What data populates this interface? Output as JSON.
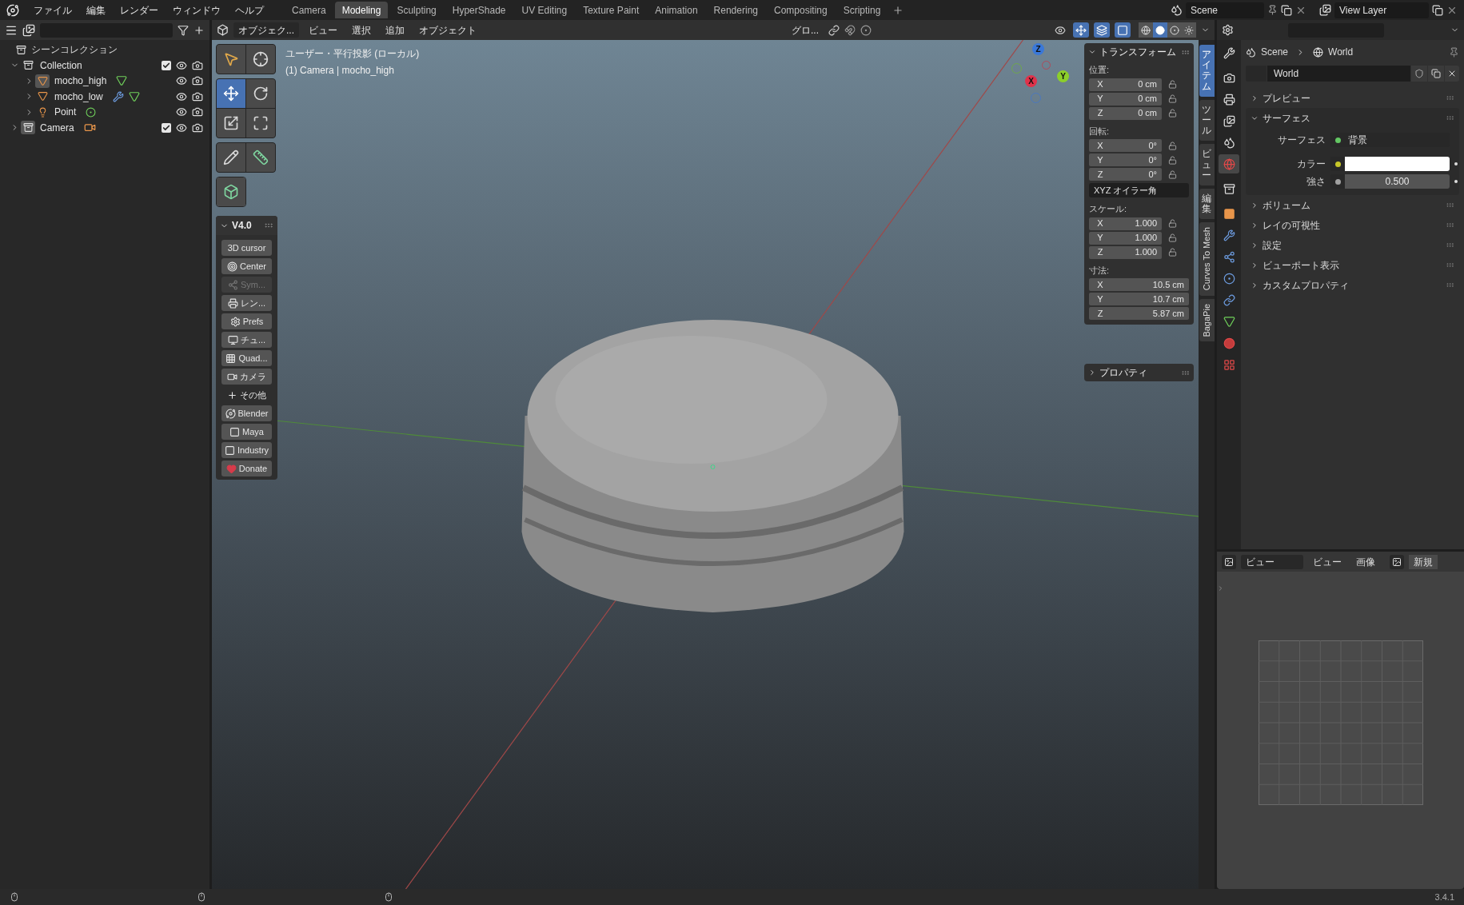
{
  "menubar": {
    "menus": [
      "ファイル",
      "編集",
      "レンダー",
      "ウィンドウ",
      "ヘルプ"
    ],
    "workspaces": [
      {
        "label": "Camera",
        "selected": false
      },
      {
        "label": "Modeling",
        "selected": true
      },
      {
        "label": "Sculpting",
        "selected": false
      },
      {
        "label": "HyperShade",
        "selected": false
      },
      {
        "label": "UV Editing",
        "selected": false
      },
      {
        "label": "Texture Paint",
        "selected": false
      },
      {
        "label": "Animation",
        "selected": false
      },
      {
        "label": "Rendering",
        "selected": false
      },
      {
        "label": "Compositing",
        "selected": false
      },
      {
        "label": "Scripting",
        "selected": false
      }
    ],
    "scene": "Scene",
    "view_layer": "View Layer"
  },
  "outliner": {
    "root": "シーンコレクション",
    "items": [
      {
        "label": "Collection",
        "kind": "collection",
        "expanded": true,
        "active": false,
        "checked": true,
        "children": [
          {
            "label": "mocho_high",
            "kind": "mesh",
            "expanded": false,
            "active": true,
            "modifier": false
          },
          {
            "label": "mocho_low",
            "kind": "mesh",
            "expanded": false,
            "active": false,
            "modifier": true
          },
          {
            "label": "Point",
            "kind": "light",
            "expanded": false,
            "active": false
          }
        ]
      },
      {
        "label": "Camera",
        "kind": "camera_collection",
        "expanded": false,
        "active": true,
        "checked": true
      }
    ]
  },
  "viewport": {
    "mode": "オブジェク...",
    "menus": [
      "ビュー",
      "選択",
      "追加",
      "オブジェクト"
    ],
    "orientation": "グロ...",
    "toggles": [
      {
        "kind": "visibility",
        "on": false
      },
      {
        "kind": "gizmo",
        "on": true
      },
      {
        "kind": "overlay",
        "on": true
      },
      {
        "kind": "xray",
        "on": true
      }
    ],
    "shading": [
      {
        "kind": "wireframe",
        "selected": false
      },
      {
        "kind": "solid",
        "selected": true
      },
      {
        "kind": "material",
        "selected": false
      },
      {
        "kind": "rendered",
        "selected": false
      }
    ],
    "overlay_text": [
      "ユーザー・平行投影 (ローカル)",
      "(1) Camera | mocho_high"
    ],
    "tool_groups": [
      {
        "tools": [
          {
            "kind": "select_box",
            "selected": false
          },
          {
            "kind": "cursor",
            "selected": false
          }
        ]
      },
      {
        "tools": [
          {
            "kind": "move",
            "selected": true
          },
          {
            "kind": "rotate",
            "selected": false
          },
          {
            "kind": "scale",
            "selected": false
          },
          {
            "kind": "transform",
            "selected": false
          }
        ]
      },
      {
        "tools": [
          {
            "kind": "annotate",
            "selected": false
          },
          {
            "kind": "measure",
            "selected": false
          }
        ]
      },
      {
        "tools": [
          {
            "kind": "add_cube",
            "selected": false
          }
        ]
      }
    ],
    "addon_panel": {
      "title": "V4.0",
      "buttons": [
        {
          "label": "3D cursor",
          "kind": "plain",
          "disabled": false
        },
        {
          "label": "Center",
          "kind": "center",
          "disabled": false
        },
        {
          "label": "Sym...",
          "kind": "sym",
          "disabled": true
        },
        {
          "label": "レン...",
          "kind": "render",
          "disabled": false
        },
        {
          "label": "Prefs",
          "kind": "prefs",
          "disabled": false
        },
        {
          "label": "チュ...",
          "kind": "tutorial",
          "disabled": false
        },
        {
          "label": "Quad...",
          "kind": "quad",
          "disabled": false
        },
        {
          "label": "カメラ",
          "kind": "camera",
          "disabled": false
        },
        {
          "label": "その他",
          "kind": "more",
          "disabled": false
        },
        {
          "label": "Blender",
          "kind": "blender",
          "disabled": false
        },
        {
          "label": "Maya",
          "kind": "maya",
          "disabled": false
        },
        {
          "label": "Industry",
          "kind": "industry",
          "disabled": false
        },
        {
          "label": "Donate",
          "kind": "donate",
          "disabled": false
        }
      ]
    },
    "gizmo": {
      "x": "X",
      "y": "Y",
      "z": "Z"
    },
    "side_tabs": [
      {
        "label": "アイテム",
        "kind": "cjk",
        "selected": true
      },
      {
        "label": "ツール",
        "kind": "cjk",
        "selected": false
      },
      {
        "label": "ビュー",
        "kind": "cjk",
        "selected": false
      },
      {
        "label": "編集",
        "kind": "cjk",
        "selected": false
      },
      {
        "label": "Curves To Mesh",
        "kind": "latin",
        "selected": false
      },
      {
        "label": "BagaPie",
        "kind": "latin",
        "selected": false
      }
    ],
    "transform": {
      "title": "トランスフォーム",
      "groups": [
        {
          "kind": "vector",
          "label": "位置:",
          "lockable": true,
          "rows": [
            {
              "axis": "X",
              "value": "0 cm"
            },
            {
              "axis": "Y",
              "value": "0 cm"
            },
            {
              "axis": "Z",
              "value": "0 cm"
            }
          ]
        },
        {
          "kind": "vector",
          "label": "回転:",
          "lockable": true,
          "rows": [
            {
              "axis": "X",
              "value": "0°"
            },
            {
              "axis": "Y",
              "value": "0°"
            },
            {
              "axis": "Z",
              "value": "0°"
            }
          ]
        },
        {
          "kind": "dropdown",
          "value": "XYZ オイラー角"
        },
        {
          "kind": "vector",
          "label": "スケール:",
          "lockable": true,
          "rows": [
            {
              "axis": "X",
              "value": "1.000"
            },
            {
              "axis": "Y",
              "value": "1.000"
            },
            {
              "axis": "Z",
              "value": "1.000"
            }
          ]
        },
        {
          "kind": "vector",
          "label": "寸法:",
          "lockable": false,
          "rows": [
            {
              "axis": "X",
              "value": "10.5 cm"
            },
            {
              "axis": "Y",
              "value": "10.7 cm"
            },
            {
              "axis": "Z",
              "value": "5.87 cm"
            }
          ]
        }
      ]
    },
    "properties_panel": {
      "title": "プロパティ",
      "expanded": false
    }
  },
  "properties": {
    "tabs": [
      {
        "kind": "tool",
        "selected": false
      },
      {
        "kind": "render",
        "selected": false
      },
      {
        "kind": "output",
        "selected": false
      },
      {
        "kind": "view_layer",
        "selected": false
      },
      {
        "kind": "scene",
        "selected": false
      },
      {
        "kind": "world",
        "selected": true
      },
      {
        "kind": "collection",
        "selected": false
      },
      {
        "kind": "object",
        "selected": false
      },
      {
        "kind": "modifier",
        "selected": false
      },
      {
        "kind": "particles",
        "selected": false
      },
      {
        "kind": "physics",
        "selected": false
      },
      {
        "kind": "constraints",
        "selected": false
      },
      {
        "kind": "data",
        "selected": false
      },
      {
        "kind": "material",
        "selected": false
      },
      {
        "kind": "texture",
        "selected": false
      }
    ],
    "breadcrumb": [
      "Scene",
      "World"
    ],
    "world": "World",
    "sections": [
      {
        "label": "プレビュー",
        "expanded": false
      },
      {
        "label": "サーフェス",
        "expanded": true,
        "fields": [
          {
            "label": "サーフェス",
            "kind": "shader",
            "value": "背景",
            "color": "#63c763"
          },
          {
            "label": "カラー",
            "kind": "color",
            "color": "#c7c729"
          },
          {
            "label": "強さ",
            "kind": "number",
            "value": "0.500",
            "color": "#a1a1a1"
          }
        ]
      },
      {
        "label": "ボリューム",
        "expanded": false
      },
      {
        "label": "レイの可視性",
        "expanded": false
      },
      {
        "label": "設定",
        "expanded": false
      },
      {
        "label": "ビューポート表示",
        "expanded": false
      },
      {
        "label": "カスタムプロパティ",
        "expanded": false
      }
    ]
  },
  "image_editor": {
    "view": "ビュー",
    "menus": [
      "ビュー",
      "画像"
    ],
    "new_button": "新規"
  },
  "status_bar": {
    "version": "3.4.1"
  }
}
